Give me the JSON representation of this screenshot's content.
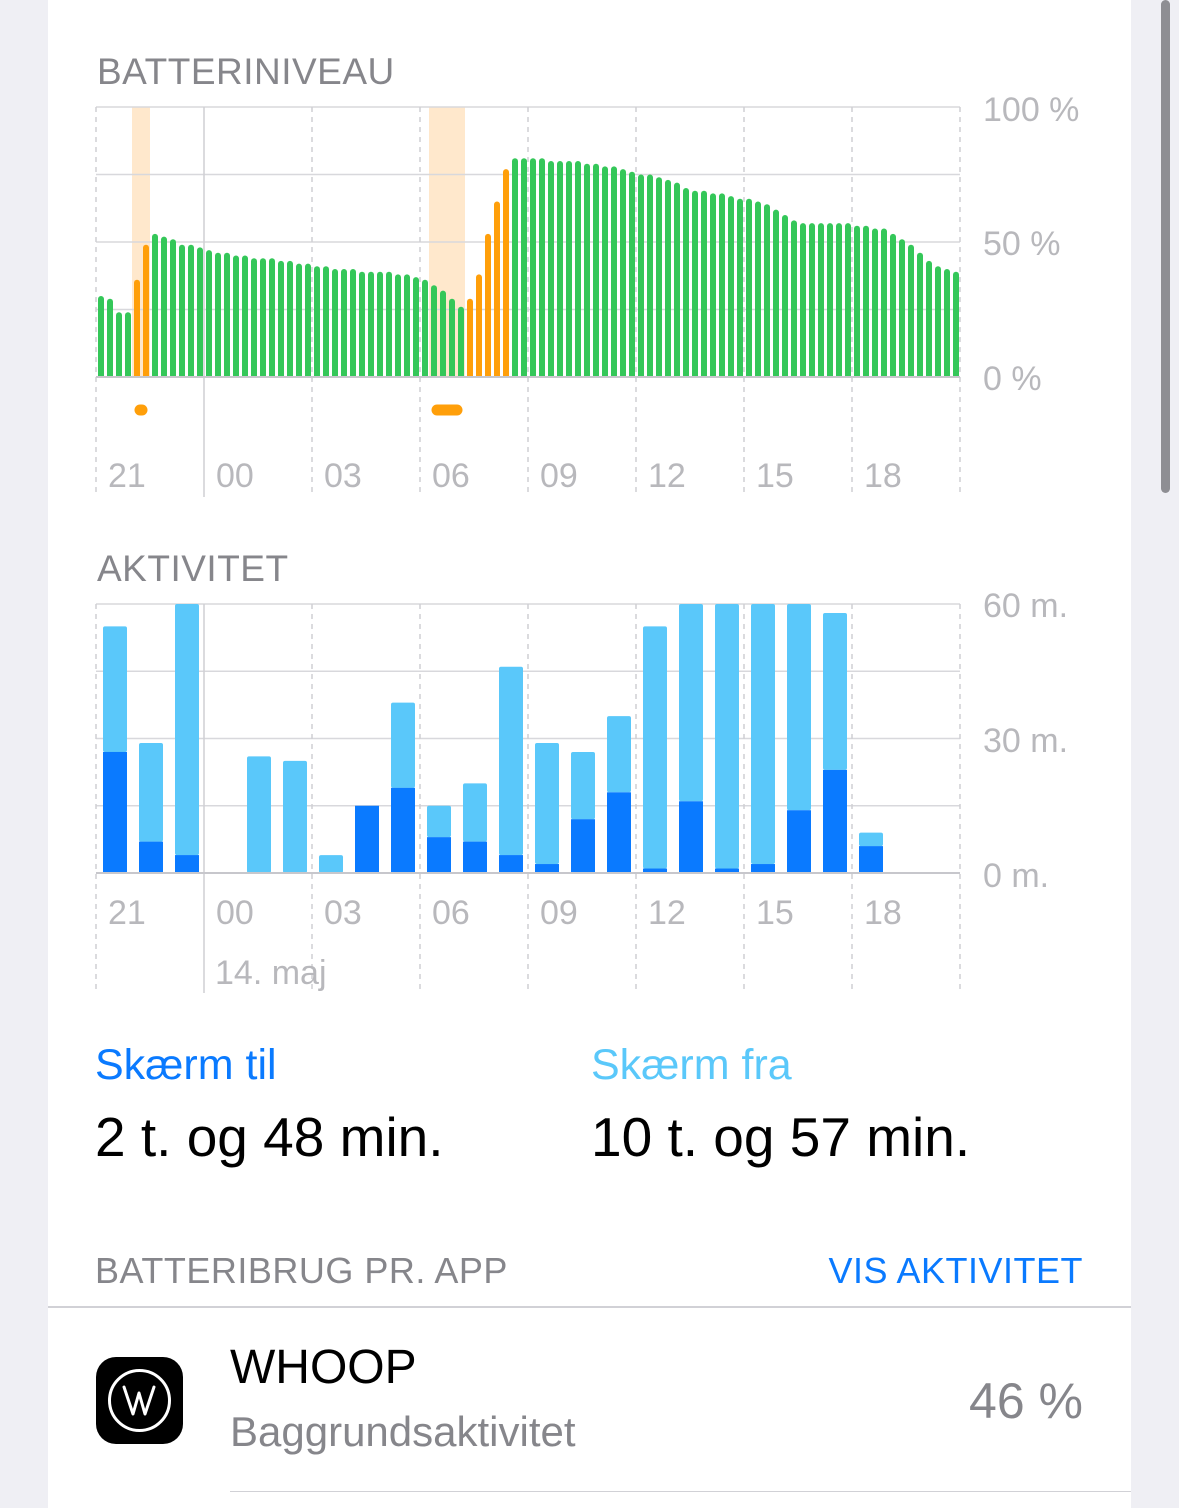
{
  "battery_section": {
    "title": "BATTERINIVEAU"
  },
  "activity_section": {
    "title": "AKTIVITET"
  },
  "chart_data": [
    {
      "type": "bar",
      "title": "BATTERINIVEAU",
      "x_tick_labels": [
        "21",
        "00",
        "03",
        "06",
        "09",
        "12",
        "15",
        "18"
      ],
      "y_tick_labels": [
        "100 %",
        "50 %",
        "0 %"
      ],
      "ylim": [
        0,
        100
      ],
      "interval_minutes": 15,
      "series": [
        {
          "name": "",
          "values": [
            30,
            29,
            24,
            24,
            36,
            49,
            53,
            52,
            51,
            49,
            49,
            48,
            47,
            46,
            46,
            45,
            45,
            44,
            44,
            44,
            43,
            43,
            42,
            42,
            41,
            41,
            40,
            40,
            40,
            39,
            39,
            39,
            39,
            38,
            38,
            37,
            36,
            34,
            32,
            29,
            26,
            29,
            38,
            53,
            65,
            77,
            81,
            81,
            81,
            81,
            80,
            80,
            80,
            80,
            79,
            79,
            78,
            78,
            77,
            76,
            75,
            75,
            74,
            73,
            72,
            70,
            69,
            69,
            68,
            68,
            67,
            66,
            66,
            65,
            64,
            62,
            60,
            58,
            57,
            57,
            57,
            57,
            57,
            57,
            56,
            56,
            55,
            55,
            53,
            51,
            49,
            46,
            43,
            41,
            40,
            39
          ],
          "charging": [
            0,
            0,
            0,
            0,
            1,
            1,
            0,
            0,
            0,
            0,
            0,
            0,
            0,
            0,
            0,
            0,
            0,
            0,
            0,
            0,
            0,
            0,
            0,
            0,
            0,
            0,
            0,
            0,
            0,
            0,
            0,
            0,
            0,
            0,
            0,
            0,
            0,
            0,
            0,
            0,
            0,
            1,
            1,
            1,
            1,
            1,
            0,
            0,
            0,
            0,
            0,
            0,
            0,
            0,
            0,
            0,
            0,
            0,
            0,
            0,
            0,
            0,
            0,
            0,
            0,
            0,
            0,
            0,
            0,
            0,
            0,
            0,
            0,
            0,
            0,
            0,
            0,
            0,
            0,
            0,
            0,
            0,
            0,
            0,
            0,
            0,
            0,
            0,
            0,
            0,
            0,
            0,
            0,
            0,
            0,
            0
          ]
        }
      ],
      "charging_periods": [
        {
          "start_hour": 22.0,
          "end_hour": 22.5
        },
        {
          "start_hour": 6.25,
          "end_hour": 7.25
        }
      ],
      "colors": {
        "battery": "#34c759",
        "charging": "#ff9f0a",
        "charging_band": "#ffe8cc"
      },
      "grid": true
    },
    {
      "type": "bar",
      "title": "AKTIVITET",
      "categories": [
        "21",
        "22",
        "23",
        "00",
        "01",
        "02",
        "03",
        "04",
        "05",
        "06",
        "07",
        "08",
        "09",
        "10",
        "11",
        "12",
        "13",
        "14",
        "15",
        "16",
        "17",
        "18"
      ],
      "x_tick_labels": [
        "21",
        "00",
        "03",
        "06",
        "09",
        "12",
        "15",
        "18"
      ],
      "date_label": "14. maj",
      "y_tick_labels": [
        "60 m.",
        "30 m.",
        "0 m."
      ],
      "ylim": [
        0,
        60
      ],
      "stacked": true,
      "series": [
        {
          "name": "Skærm til",
          "color": "#0a7aff",
          "values": [
            27,
            7,
            4,
            0,
            0,
            0,
            0,
            15,
            19,
            8,
            7,
            4,
            2,
            12,
            18,
            1,
            16,
            1,
            2,
            14,
            23,
            6
          ]
        },
        {
          "name": "Skærm fra",
          "color": "#5ac8fa",
          "values": [
            28,
            22,
            56,
            0,
            26,
            25,
            4,
            0,
            19,
            7,
            13,
            42,
            27,
            15,
            17,
            54,
            44,
            59,
            58,
            46,
            35,
            3
          ]
        }
      ],
      "grid": true
    }
  ],
  "screen_on": {
    "label": "Skærm til",
    "value": "2 t. og 48 min.",
    "color": "#0a7aff"
  },
  "screen_off": {
    "label": "Skærm fra",
    "value": "10 t. og 57 min.",
    "color": "#5ac8fa"
  },
  "app_list": {
    "header": "BATTERIBRUG PR. APP",
    "action": "VIS AKTIVITET",
    "items": [
      {
        "name": "WHOOP",
        "subtitle": "Baggrundsaktivitet",
        "percent": "46 %",
        "icon": "whoop-logo-icon"
      }
    ]
  }
}
